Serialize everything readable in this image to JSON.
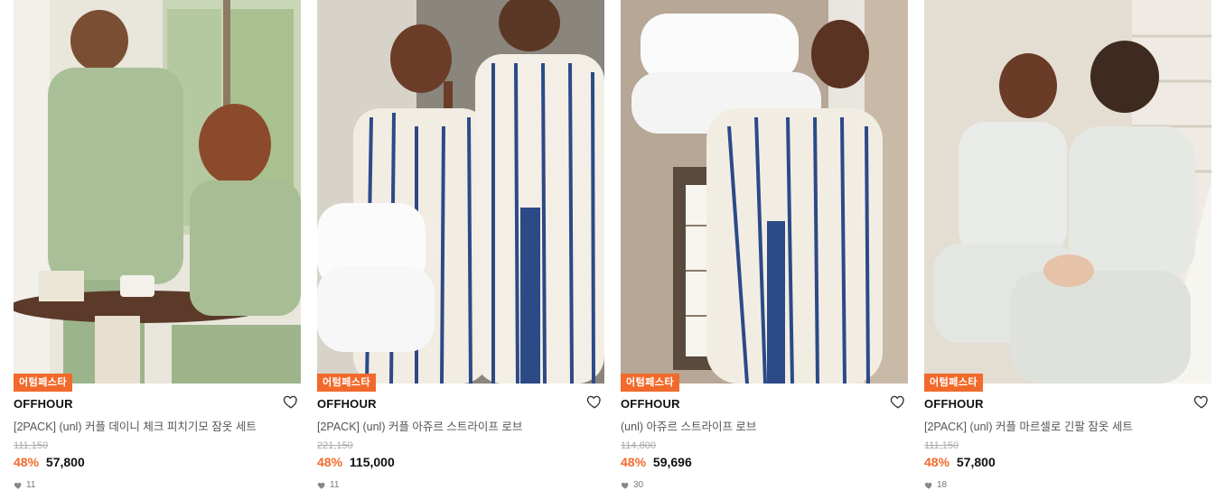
{
  "products": [
    {
      "badge": "어텀페스타",
      "brand": "OFFHOUR",
      "name": "[2PACK] (unl) 커플 데이니 체크 피치기모 잠옷 세트",
      "original_price": "111,150",
      "discount": "48%",
      "sale_price": "57,800",
      "likes": "11",
      "image_theme": "green-check-pajama-couple"
    },
    {
      "badge": "어텀페스타",
      "brand": "OFFHOUR",
      "name": "[2PACK] (unl) 커플 아쥬르 스트라이프 로브",
      "original_price": "221,150",
      "discount": "48%",
      "sale_price": "115,000",
      "likes": "11",
      "image_theme": "striped-robe-couple"
    },
    {
      "badge": "어텀페스타",
      "brand": "OFFHOUR",
      "name": "(unl) 아쥬르 스트라이프 로브",
      "original_price": "114,800",
      "discount": "48%",
      "sale_price": "59,696",
      "likes": "30",
      "image_theme": "striped-robe-pillows"
    },
    {
      "badge": "어텀페스타",
      "brand": "OFFHOUR",
      "name": "[2PACK] (unl) 커플 마르셀로 긴팔 잠옷 세트",
      "original_price": "111,150",
      "discount": "48%",
      "sale_price": "57,800",
      "likes": "18",
      "image_theme": "floral-pajama-stairs"
    }
  ],
  "colors": {
    "accent": "#f26a2b",
    "brand_text": "#111111",
    "muted": "#aaaaaa"
  },
  "icons": {
    "wishlist": "heart-outline-icon",
    "likes": "heart-filled-icon"
  }
}
